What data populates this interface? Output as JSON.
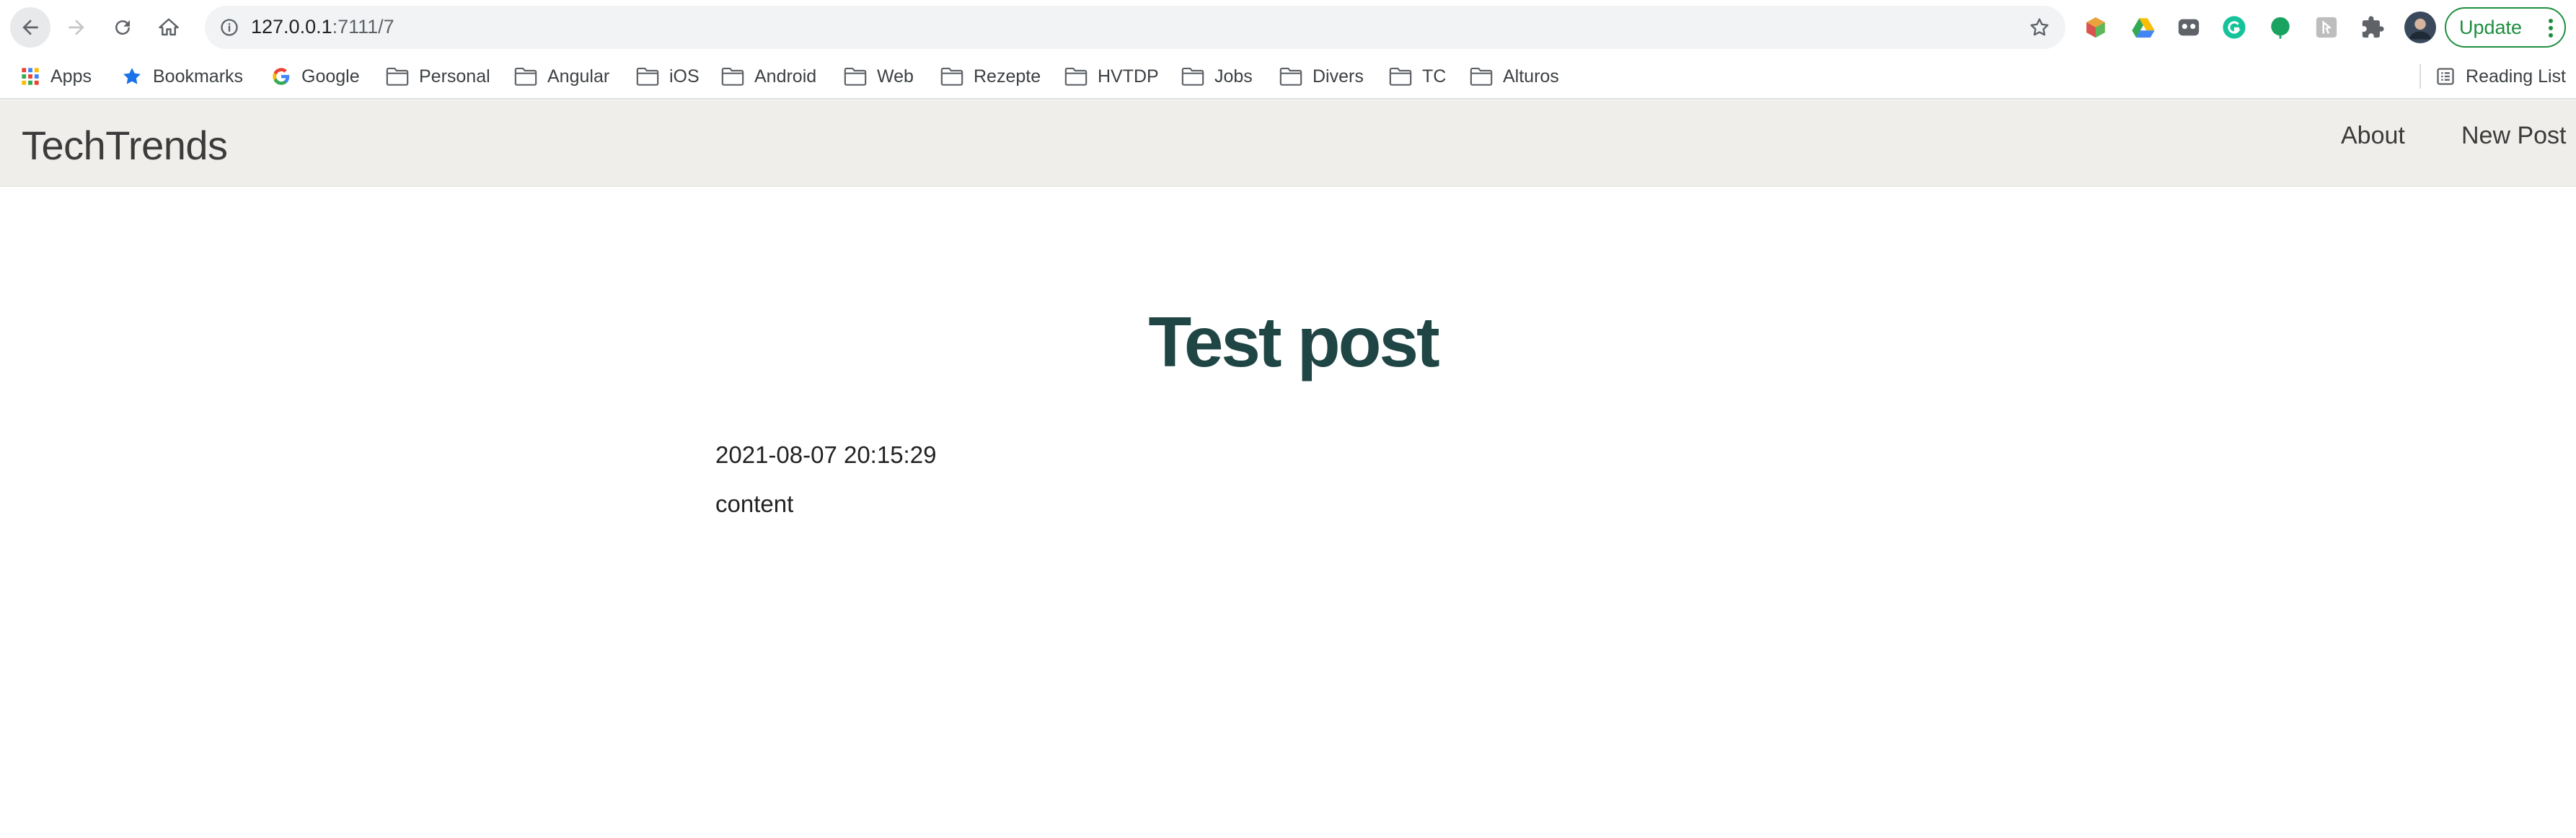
{
  "browser": {
    "url_host": "127.0.0.1",
    "url_path": ":7111/7",
    "update_label": "Update",
    "nav_icons": [
      "back-arrow-icon",
      "forward-arrow-icon",
      "reload-icon",
      "home-icon"
    ],
    "extension_icons": [
      "cube-extension-icon",
      "google-drive-icon",
      "mask-extension-icon",
      "grammarly-icon",
      "green-leaf-extension-icon",
      "gray-extension-icon",
      "puzzle-icon",
      "profile-avatar"
    ]
  },
  "bookmarks": {
    "items": [
      {
        "label": "Apps",
        "icon": "apps-grid-icon"
      },
      {
        "label": "Bookmarks",
        "icon": "star-icon"
      },
      {
        "label": "Google",
        "icon": "google-icon"
      },
      {
        "label": "Personal",
        "icon": "folder-icon"
      },
      {
        "label": "Angular",
        "icon": "folder-icon"
      },
      {
        "label": "iOS",
        "icon": "folder-icon"
      },
      {
        "label": "Android",
        "icon": "folder-icon"
      },
      {
        "label": "Web",
        "icon": "folder-icon"
      },
      {
        "label": "Rezepte",
        "icon": "folder-icon"
      },
      {
        "label": "HVTDP",
        "icon": "folder-icon"
      },
      {
        "label": "Jobs",
        "icon": "folder-icon"
      },
      {
        "label": "Divers",
        "icon": "folder-icon"
      },
      {
        "label": "TC",
        "icon": "folder-icon"
      },
      {
        "label": "Alturos",
        "icon": "folder-icon"
      }
    ],
    "reading_list": "Reading List"
  },
  "site": {
    "brand": "TechTrends",
    "nav": {
      "about": "About",
      "new_post": "New Post"
    }
  },
  "post": {
    "title": "Test post",
    "created": "2021-08-07 20:15:29",
    "content": "content"
  },
  "colors": {
    "header_bg": "#efeeeb",
    "title": "#1f4545",
    "update_green": "#1e8e3e"
  }
}
